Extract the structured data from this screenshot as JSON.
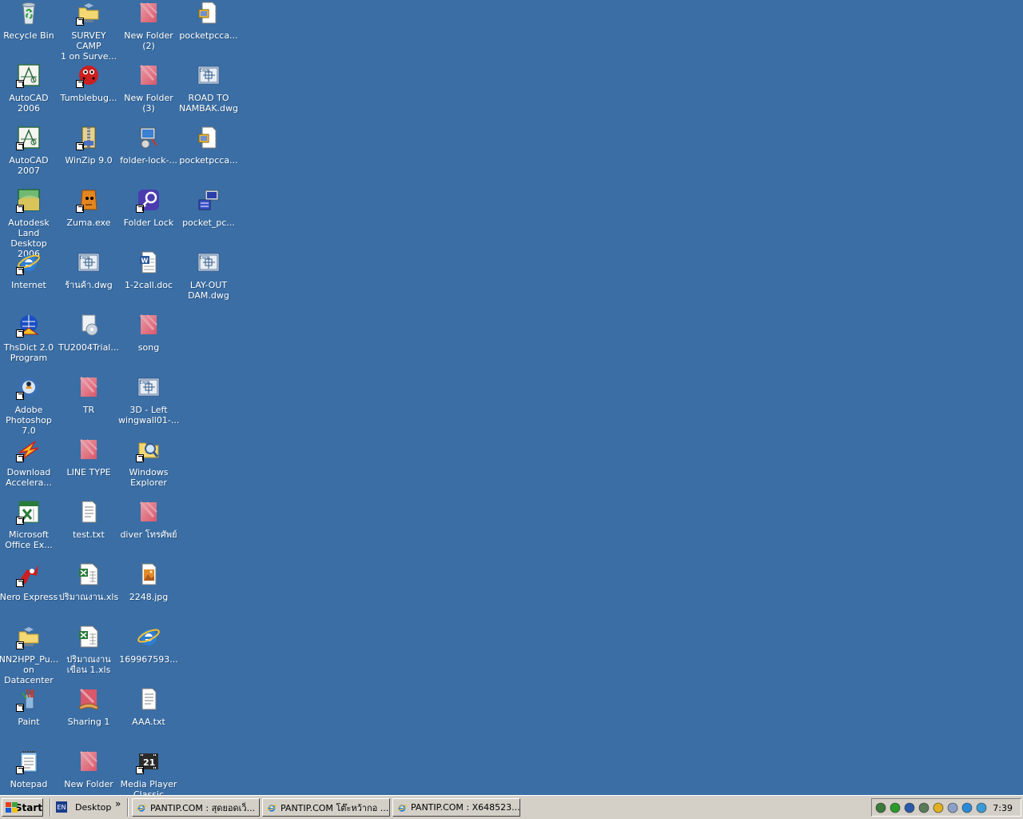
{
  "desktop": {
    "background": "#3a6ea5",
    "columns": [
      [
        {
          "label": "Recycle Bin",
          "icon": "recycle-bin-icon",
          "shortcut": false
        },
        {
          "label": "AutoCAD 2006",
          "icon": "autocad-icon",
          "shortcut": true
        },
        {
          "label": "AutoCAD 2007",
          "icon": "autocad-icon",
          "shortcut": true
        },
        {
          "label": "Autodesk Land\nDesktop 2006",
          "icon": "land-desktop-icon",
          "shortcut": true
        },
        {
          "label": "Internet",
          "icon": "internet-explorer-icon",
          "shortcut": true
        },
        {
          "label": "ThsDict 2.0\nProgram",
          "icon": "thsdict-icon",
          "shortcut": true
        },
        {
          "label": "Adobe\nPhotoshop 7.0",
          "icon": "photoshop-icon",
          "shortcut": true
        },
        {
          "label": "Download\nAccelera...",
          "icon": "download-accelerator-icon",
          "shortcut": true
        },
        {
          "label": "Microsoft\nOffice Ex...",
          "icon": "excel-icon",
          "shortcut": true
        },
        {
          "label": "Nero Express",
          "icon": "nero-icon",
          "shortcut": true
        },
        {
          "label": "NN2HPP_Pu...\non Datacenter",
          "icon": "network-folder-icon",
          "shortcut": true
        },
        {
          "label": "Paint",
          "icon": "paint-icon",
          "shortcut": true
        },
        {
          "label": "Notepad",
          "icon": "notepad-icon",
          "shortcut": true
        }
      ],
      [
        {
          "label": "SURVEY CAMP\n1 on Surve...",
          "icon": "network-folder-icon",
          "shortcut": true
        },
        {
          "label": "Tumblebug...",
          "icon": "tumblebugs-icon",
          "shortcut": true
        },
        {
          "label": "WinZip 9.0",
          "icon": "winzip-icon",
          "shortcut": true
        },
        {
          "label": "Zuma.exe",
          "icon": "zuma-icon",
          "shortcut": true
        },
        {
          "label": "ร้านค้า.dwg",
          "icon": "dwg-file-icon",
          "shortcut": false
        },
        {
          "label": "TU2004Trial...",
          "icon": "installer-icon",
          "shortcut": false
        },
        {
          "label": "TR",
          "icon": "folder-icon",
          "shortcut": false
        },
        {
          "label": "LINE TYPE",
          "icon": "folder-icon",
          "shortcut": false
        },
        {
          "label": "test.txt",
          "icon": "text-file-icon",
          "shortcut": false
        },
        {
          "label": "ปริมาณงาน.xls",
          "icon": "xls-file-icon",
          "shortcut": false
        },
        {
          "label": "ปริมาณงาน\nเขื่อน 1.xls",
          "icon": "xls-file-icon",
          "shortcut": false
        },
        {
          "label": "Sharing 1",
          "icon": "shared-folder-icon",
          "shortcut": false
        },
        {
          "label": "New Folder",
          "icon": "folder-icon",
          "shortcut": false
        }
      ],
      [
        {
          "label": "New Folder (2)",
          "icon": "folder-icon",
          "shortcut": false
        },
        {
          "label": "New Folder (3)",
          "icon": "folder-icon",
          "shortcut": false
        },
        {
          "label": "folder-lock-...",
          "icon": "setup-icon",
          "shortcut": false
        },
        {
          "label": "Folder Lock",
          "icon": "folder-lock-icon",
          "shortcut": true
        },
        {
          "label": "1-2call.doc",
          "icon": "word-doc-icon",
          "shortcut": false
        },
        {
          "label": "song",
          "icon": "folder-icon",
          "shortcut": false
        },
        {
          "label": "3D - Left\nwingwall01-...",
          "icon": "dwg-file-icon",
          "shortcut": false
        },
        {
          "label": "Windows\nExplorer",
          "icon": "windows-explorer-icon",
          "shortcut": true
        },
        {
          "label": "diver โทรศัพย์",
          "icon": "folder-icon",
          "shortcut": false
        },
        {
          "label": "2248.jpg",
          "icon": "jpg-file-icon",
          "shortcut": false
        },
        {
          "label": "169967593...",
          "icon": "internet-explorer-icon",
          "shortcut": false
        },
        {
          "label": "AAA.txt",
          "icon": "text-file-icon",
          "shortcut": false
        },
        {
          "label": "Media Player\nClassic",
          "icon": "media-player-icon",
          "shortcut": true
        }
      ],
      [
        {
          "label": "pocketpcca...",
          "icon": "archive-icon",
          "shortcut": false
        },
        {
          "label": "ROAD TO\nNAMBAK.dwg",
          "icon": "dwg-file-icon",
          "shortcut": false
        },
        {
          "label": "pocketpcca...",
          "icon": "archive-icon",
          "shortcut": false
        },
        {
          "label": "pocket_pc...",
          "icon": "computer-app-icon",
          "shortcut": false
        },
        {
          "label": "LAY-OUT\nDAM.dwg",
          "icon": "dwg-file-icon",
          "shortcut": false
        }
      ]
    ]
  },
  "taskbar": {
    "start_label": "Start",
    "language": "EN",
    "toolbar_label": "Desktop",
    "toolbar_chevron": "»",
    "tasks": [
      {
        "label": "PANTIP.COM : สุดยอดเว็...",
        "icon": "internet-explorer-icon"
      },
      {
        "label": "PANTIP.COM โต๊ะหว้ากอ ...",
        "icon": "internet-explorer-icon"
      },
      {
        "label": "PANTIP.COM : X648523...",
        "icon": "internet-explorer-icon"
      }
    ],
    "tray_icons": [
      "network-icon",
      "antivirus-icon",
      "display-icon",
      "connection-icon",
      "messenger-icon",
      "volume-icon",
      "sync-icon",
      "update-icon"
    ],
    "clock": "7:39"
  }
}
